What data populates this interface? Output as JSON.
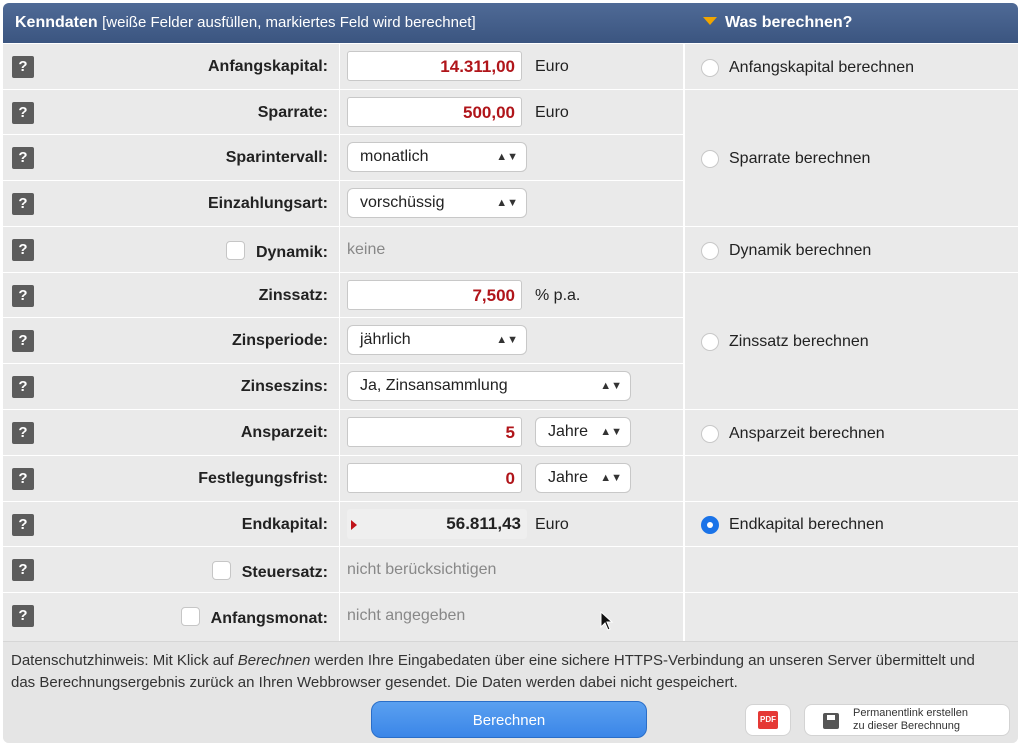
{
  "header": {
    "title": "Kenndaten",
    "subtitle": "[weiße Felder ausfüllen, markiertes Feld wird berechnet]",
    "right_title": "Was berechnen?"
  },
  "help_label": "?",
  "rows": {
    "anfangskapital": {
      "label": "Anfangskapital:",
      "value": "14.311,00",
      "unit": "Euro"
    },
    "sparrate": {
      "label": "Sparrate:",
      "value": "500,00",
      "unit": "Euro"
    },
    "sparintervall": {
      "label": "Sparintervall:",
      "selected": "monatlich"
    },
    "einzahlungsart": {
      "label": "Einzahlungsart:",
      "selected": "vorschüssig"
    },
    "dynamik": {
      "label": "Dynamik:",
      "value": "keine"
    },
    "zinssatz": {
      "label": "Zinssatz:",
      "value": "7,500",
      "unit": "% p.a."
    },
    "zinsperiode": {
      "label": "Zinsperiode:",
      "selected": "jährlich"
    },
    "zinseszins": {
      "label": "Zinseszins:",
      "selected": "Ja, Zinsansammlung"
    },
    "ansparzeit": {
      "label": "Ansparzeit:",
      "value": "5",
      "unit_selected": "Jahre"
    },
    "festlegungsfrist": {
      "label": "Festlegungsfrist:",
      "value": "0",
      "unit_selected": "Jahre"
    },
    "endkapital": {
      "label": "Endkapital:",
      "value": "56.811,43",
      "unit": "Euro"
    },
    "steuersatz": {
      "label": "Steuersatz:",
      "value": "nicht berücksichtigen"
    },
    "anfangsmonat": {
      "label": "Anfangsmonat:",
      "value": "nicht angegeben"
    }
  },
  "calc_options": {
    "anfangskapital": "Anfangskapital berechnen",
    "sparrate": "Sparrate berechnen",
    "dynamik": "Dynamik berechnen",
    "zinssatz": "Zinssatz berechnen",
    "ansparzeit": "Ansparzeit berechnen",
    "endkapital": "Endkapital berechnen",
    "selected": "endkapital"
  },
  "footer": {
    "privacy_pre": "Datenschutzhinweis: Mit Klick auf ",
    "privacy_em": "Berechnen",
    "privacy_post": " werden Ihre Eingabedaten über eine sichere HTTPS-Verbindung an unseren Server übermittelt und das Berechnungsergebnis zurück an Ihren Webbrowser gesendet. Die Daten werden dabei nicht gespeichert.",
    "calc_button": "Berechnen",
    "pdf_label": "PDF",
    "permalink_line1": "Permanentlink erstellen",
    "permalink_line2": "zu dieser Berechnung"
  },
  "colors": {
    "header": "#3b5580",
    "input_value": "#b0151a",
    "accent": "#1a73e8"
  }
}
